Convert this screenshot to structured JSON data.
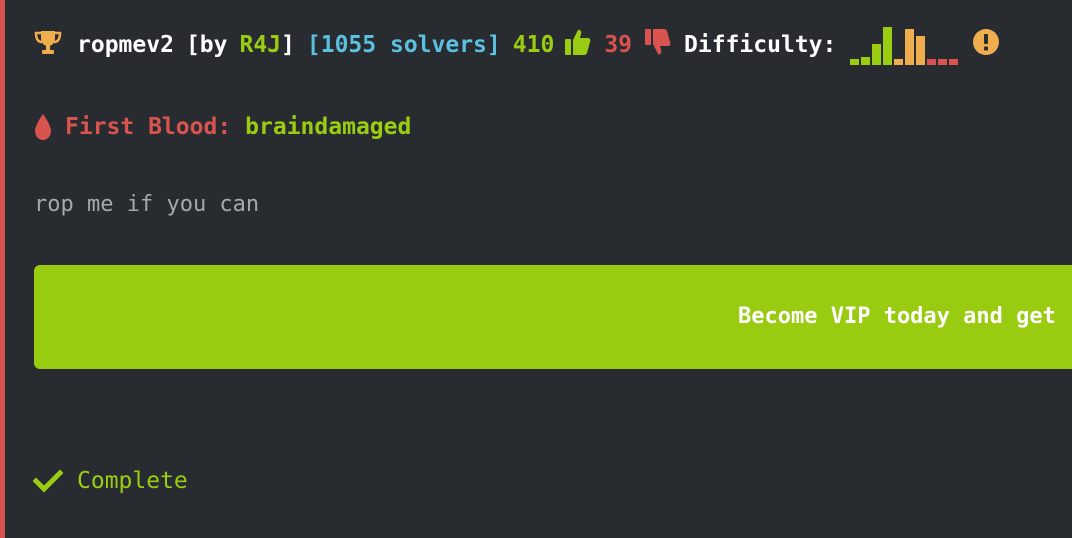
{
  "colors": {
    "accent_green": "#9acd12",
    "accent_red": "#d9534f",
    "accent_blue": "#5bc0de",
    "accent_orange": "#f0ad4e",
    "background": "#282c31",
    "banner_green": "#99cc11"
  },
  "challenge": {
    "name": "ropmev2",
    "by_prefix": "[by",
    "author": "R4J",
    "by_suffix": "]",
    "solvers": "[1055 solvers]",
    "likes": "410",
    "dislikes": "39",
    "difficulty_label": "Difficulty:",
    "difficulty_distribution": [
      {
        "level": 1,
        "share": 0.15,
        "color": "#9acd12"
      },
      {
        "level": 2,
        "share": 0.2,
        "color": "#9acd12"
      },
      {
        "level": 3,
        "share": 0.55,
        "color": "#9acd12"
      },
      {
        "level": 4,
        "share": 1.0,
        "color": "#9acd12"
      },
      {
        "level": 5,
        "share": 0.15,
        "color": "#f0ad4e"
      },
      {
        "level": 6,
        "share": 0.95,
        "color": "#f0ad4e"
      },
      {
        "level": 7,
        "share": 0.75,
        "color": "#f0ad4e"
      },
      {
        "level": 8,
        "share": 0.15,
        "color": "#d9534f"
      },
      {
        "level": 9,
        "share": 0.15,
        "color": "#d9534f"
      },
      {
        "level": 10,
        "share": 0.15,
        "color": "#d9534f"
      }
    ],
    "icons": {
      "trophy": "trophy-icon",
      "like": "thumbs-up-icon",
      "dislike": "thumbs-down-icon",
      "info": "exclamation-circle-icon",
      "blood": "blood-drop-icon",
      "check": "check-icon"
    }
  },
  "first_blood": {
    "label": "First Blood:",
    "user": "braindamaged"
  },
  "description": "rop me if you can",
  "vip_banner": {
    "text": "Become VIP today and get"
  },
  "status": {
    "label": "Complete"
  }
}
